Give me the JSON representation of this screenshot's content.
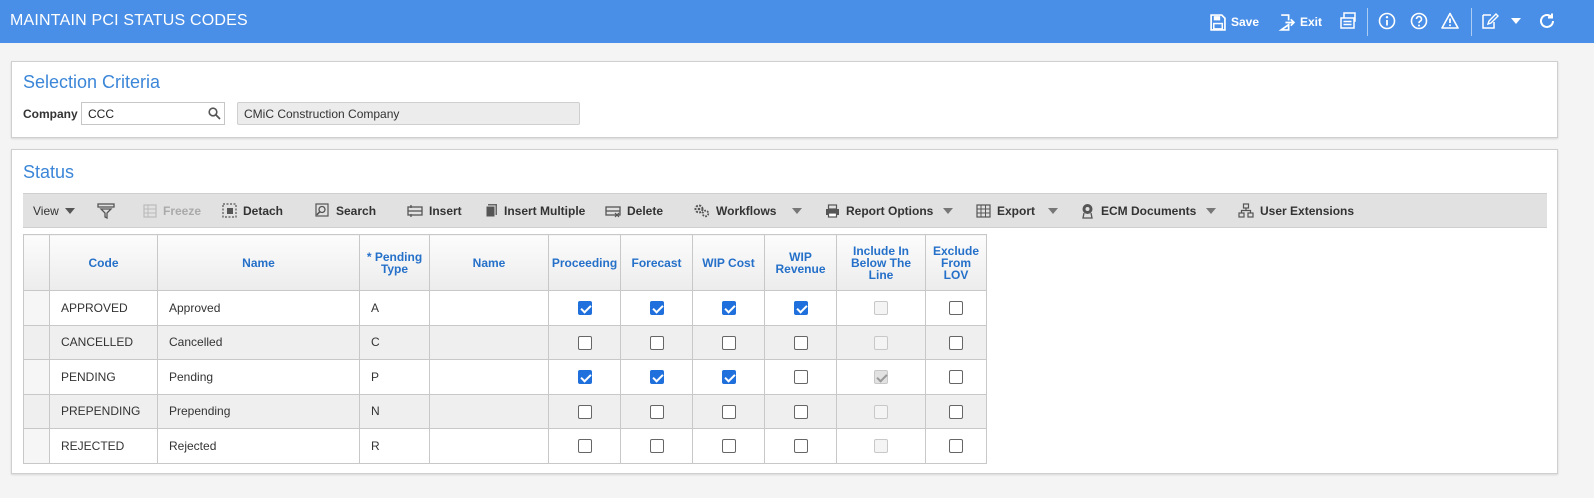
{
  "app": {
    "title": "MAINTAIN PCI STATUS CODES",
    "save_label": "Save",
    "exit_label": "Exit",
    "colors": {
      "header": "#4a8fe7",
      "accent": "#3b86d8",
      "check": "#1f6fdc"
    }
  },
  "selection": {
    "title": "Selection Criteria",
    "company_label": "Company",
    "company_value": "CCC",
    "company_name": "CMiC Construction Company"
  },
  "status": {
    "title": "Status",
    "toolbar": {
      "view": "View",
      "freeze": "Freeze",
      "detach": "Detach",
      "search": "Search",
      "insert": "Insert",
      "insert_multiple": "Insert Multiple",
      "delete": "Delete",
      "workflows": "Workflows",
      "report_options": "Report Options",
      "export": "Export",
      "ecm_documents": "ECM Documents",
      "user_extensions": "User Extensions"
    },
    "columns": {
      "code": "Code",
      "name": "Name",
      "pending_type_1": "* Pending",
      "pending_type_2": "Type",
      "pending_name": "Name",
      "proceeding": "Proceeding",
      "forecast": "Forecast",
      "wip_cost": "WIP Cost",
      "wip_revenue_1": "WIP",
      "wip_revenue_2": "Revenue",
      "below_line_1": "Include In",
      "below_line_2": "Below The",
      "below_line_3": "Line",
      "exclude_lov_1": "Exclude",
      "exclude_lov_2": "From",
      "exclude_lov_3": "LOV"
    },
    "rows": [
      {
        "code": "APPROVED",
        "name": "Approved",
        "pending_type": "A",
        "pending_name": "",
        "proceeding": true,
        "forecast": true,
        "wip_cost": true,
        "wip_revenue": true,
        "below_line": false,
        "exclude_lov": false
      },
      {
        "code": "CANCELLED",
        "name": "Cancelled",
        "pending_type": "C",
        "pending_name": "",
        "proceeding": false,
        "forecast": false,
        "wip_cost": false,
        "wip_revenue": false,
        "below_line": false,
        "exclude_lov": false
      },
      {
        "code": "PENDING",
        "name": "Pending",
        "pending_type": "P",
        "pending_name": "",
        "proceeding": true,
        "forecast": true,
        "wip_cost": true,
        "wip_revenue": false,
        "below_line": true,
        "exclude_lov": false
      },
      {
        "code": "PREPENDING",
        "name": "Prepending",
        "pending_type": "N",
        "pending_name": "",
        "proceeding": false,
        "forecast": false,
        "wip_cost": false,
        "wip_revenue": false,
        "below_line": false,
        "exclude_lov": false
      },
      {
        "code": "REJECTED",
        "name": "Rejected",
        "pending_type": "R",
        "pending_name": "",
        "proceeding": false,
        "forecast": false,
        "wip_cost": false,
        "wip_revenue": false,
        "below_line": false,
        "exclude_lov": false
      }
    ]
  }
}
